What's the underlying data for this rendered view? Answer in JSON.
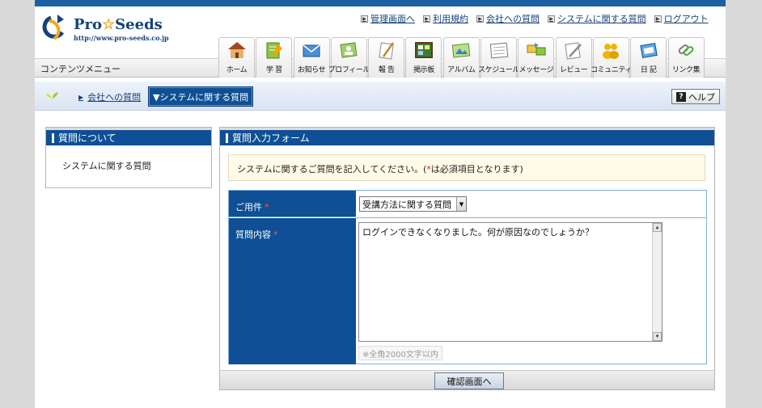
{
  "brand": {
    "name_part1": "Pro",
    "name_star": "☆",
    "name_part2": "Seeds",
    "url": "http://www.pro-seeds.co.jp"
  },
  "top_links": [
    {
      "label": "管理画面へ"
    },
    {
      "label": "利用規約"
    },
    {
      "label": "会社への質問"
    },
    {
      "label": "システムに関する質問"
    },
    {
      "label": "ログアウト"
    }
  ],
  "menu_title": "コンテンツメニュー",
  "nav": [
    {
      "label": "ホーム",
      "icon": "home-icon"
    },
    {
      "label": "学 習",
      "icon": "study-icon"
    },
    {
      "label": "お知らせ",
      "icon": "mail-icon"
    },
    {
      "label": "プロフィール",
      "icon": "profile-icon"
    },
    {
      "label": "報 告",
      "icon": "report-icon"
    },
    {
      "label": "掲示板",
      "icon": "board-icon"
    },
    {
      "label": "アルバム",
      "icon": "album-icon"
    },
    {
      "label": "スケジュール",
      "icon": "schedule-icon"
    },
    {
      "label": "メッセージ",
      "icon": "message-icon"
    },
    {
      "label": "レビュー",
      "icon": "review-icon"
    },
    {
      "label": "コミュニティ",
      "icon": "community-icon"
    },
    {
      "label": "日 記",
      "icon": "diary-icon"
    },
    {
      "label": "リンク集",
      "icon": "links-icon"
    }
  ],
  "breadcrumb": {
    "link": "会社への質問",
    "current": "▼システムに関する質問"
  },
  "help_label": "ヘルプ",
  "left_panel": {
    "title": "質問について",
    "item": "システムに関する質問"
  },
  "form": {
    "title": "質問入力フォーム",
    "notice_prefix": "システムに関するご質問を記入してください。(",
    "notice_star": "*",
    "notice_suffix": "は必須項目となります)",
    "youken_label": "ご用件",
    "required_mark": "*",
    "select_value": "受講方法に関する質問",
    "naiyo_label": "質問内容",
    "textarea_value": "ログインできなくなりました。何が原因なのでしょうか？",
    "char_note": "※全角2000文字以内",
    "confirm_button": "確認画面へ"
  },
  "colors": {
    "brand_blue": "#0e4f95",
    "top_bar": "#1b5fa3",
    "required": "#d61a1a",
    "notice_bg": "#fffbe8"
  }
}
